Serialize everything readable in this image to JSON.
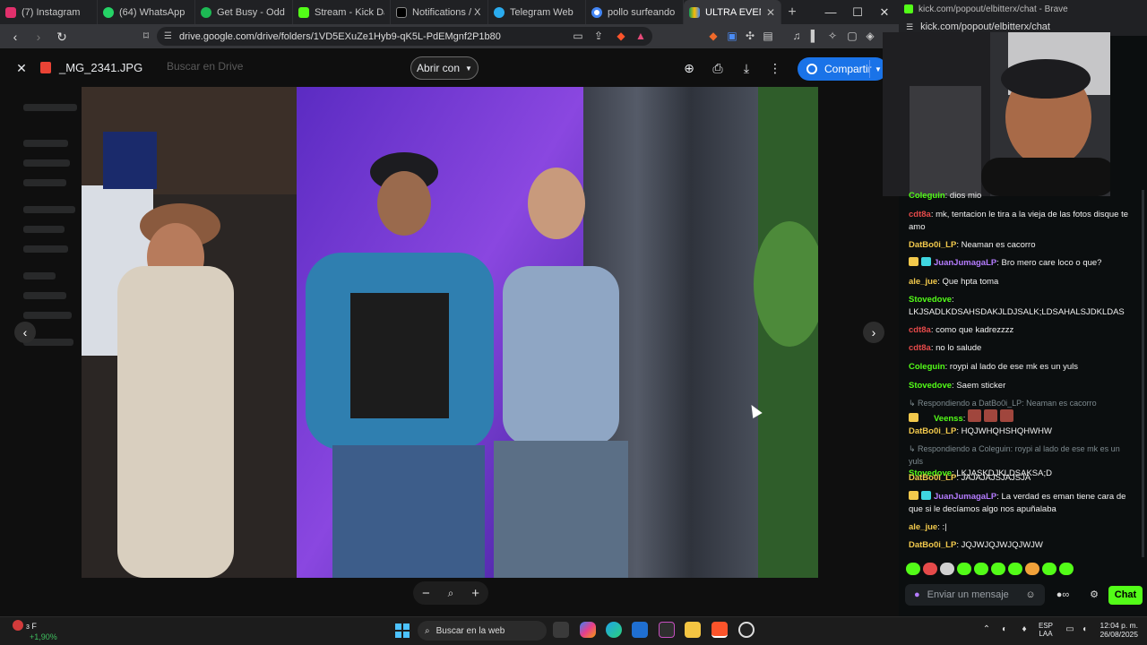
{
  "browser": {
    "tabs": [
      {
        "label": "(7) Instagram",
        "icon": "instagram-icon",
        "color": "#e1306c"
      },
      {
        "label": "(64) WhatsApp",
        "icon": "whatsapp-icon",
        "color": "#25d366"
      },
      {
        "label": "Get Busy - Odd M",
        "icon": "spotify-icon",
        "color": "#1db954"
      },
      {
        "label": "Stream - Kick Dashb",
        "icon": "kick-icon",
        "color": "#53fc18"
      },
      {
        "label": "Notifications / X",
        "icon": "x-icon",
        "color": "#ffffff"
      },
      {
        "label": "Telegram Web",
        "icon": "telegram-icon",
        "color": "#2aabee"
      },
      {
        "label": "pollo surfeando - Bu",
        "icon": "google-icon",
        "color": "#4285f4"
      },
      {
        "label": "ULTRA EVENTO",
        "icon": "drive-icon",
        "color": "#fbbc04"
      }
    ],
    "url": "drive.google.com/drive/folders/1VD5EXuZe1Hyb9-qK5L-PdEMgnf2P1b80",
    "new_tab": "+"
  },
  "viewer": {
    "file_name": "_MG_2341.JPG",
    "search_placeholder": "Buscar en Drive",
    "open_with_label": "Abrir con",
    "share_label": "Compartir",
    "zoom_minus": "−",
    "zoom_plus": "+"
  },
  "chat": {
    "window_title": "kick.com/popout/elbitterx/chat - Brave",
    "url": "kick.com/popout/elbitterx/chat",
    "messages": [
      {
        "user": "Coleguin",
        "text": "dios mio",
        "color": "#53fc18"
      },
      {
        "user": "cdt8a",
        "text": "mk, tentacion le tira a la vieja de las fotos disque te amo",
        "color": "#e54a4a"
      },
      {
        "user": "DatBo0i_LP",
        "text": "Neaman es cacorro",
        "color": "#f2c94c"
      },
      {
        "user": "JuanJumagaLP",
        "text": "Bro mero care loco o que?",
        "color": "#b57cff"
      },
      {
        "user": "ale_jue",
        "text": "Que hpta toma",
        "color": "#f2c94c"
      },
      {
        "user": "Stovedove",
        "text": "LKJSADLKDSAHSDAKJLDJSALK;LDSAHALSJDKLDAS",
        "color": "#53fc18"
      },
      {
        "user": "cdt8a",
        "text": "como que kadrezzzz",
        "color": "#e54a4a"
      },
      {
        "user": "cdt8a",
        "text": "no lo salude",
        "color": "#e54a4a"
      },
      {
        "user": "Coleguin",
        "text": "roypi al lado de ese mk es un yuls",
        "color": "#53fc18"
      },
      {
        "user": "Stovedove",
        "text": "Saem sticker",
        "color": "#53fc18"
      },
      {
        "reply": "Respondiendo a DatBo0i_LP: Neaman es cacorro",
        "user": "Veenss",
        "text": "",
        "color": "#53fc18"
      },
      {
        "user": "DatBo0i_LP",
        "text": "HQJWHQHSHQHWHW",
        "color": "#f2c94c"
      },
      {
        "reply": "Respondiendo a Coleguin: roypi al lado de ese mk es un yuls",
        "user": "Stovedove",
        "text": "LKJASKDJKLDSAKSA;D",
        "color": "#53fc18"
      },
      {
        "user": "DatBo0i_LP",
        "text": "JAJAJAJSJAJSJA",
        "color": "#f2c94c"
      },
      {
        "user": "JuanJumagaLP",
        "text": "La verdad es eman tiene cara de que si le decíamos algo nos apuñalaba",
        "color": "#b57cff"
      },
      {
        "user": "ale_jue",
        "text": ":|",
        "color": "#f2c94c"
      },
      {
        "user": "DatBo0i_LP",
        "text": "JQJWJQJWJQJWJW",
        "color": "#f2c94c"
      }
    ],
    "input_placeholder": "Enviar un mensaje",
    "send_label": "Chat"
  },
  "taskbar": {
    "weather_badge": "3",
    "weather_title": "F",
    "weather_delta": "+1,90%",
    "search_placeholder": "Buscar en la web",
    "lang_top": "ESP",
    "lang_bottom": "LAA",
    "time": "12:04 p. m.",
    "date": "26/08/2025"
  }
}
